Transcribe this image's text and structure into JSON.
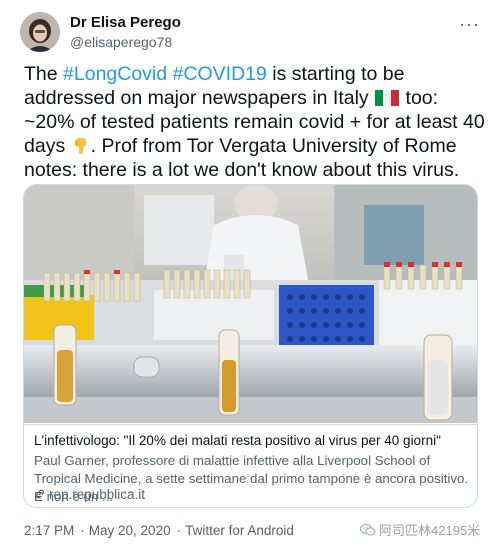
{
  "author": {
    "name": "Dr Elisa Perego",
    "handle": "@elisaperego78"
  },
  "menu_icon": "more-horizontal-icon",
  "tweet": {
    "segments": [
      {
        "text": "The ",
        "type": "text"
      },
      {
        "text": "#LongCovid",
        "type": "hashtag"
      },
      {
        "text": " ",
        "type": "text"
      },
      {
        "text": "#COVID19",
        "type": "hashtag"
      },
      {
        "text": " is starting to be addressed on major newspapers in Italy ",
        "type": "text"
      },
      {
        "type": "emoji",
        "name": "italy-flag-icon"
      },
      {
        "text": " too: ~20% of tested patients remain covid + for at least 40 days ",
        "type": "text"
      },
      {
        "type": "emoji",
        "name": "pointing-down-icon"
      },
      {
        "text": ". Prof from Tor Vergata University of Rome notes: there is a lot we don't know about this virus.",
        "type": "text"
      }
    ]
  },
  "card": {
    "title": "L'infettivologo: \"Il 20% dei malati resta positivo al virus per 40 giorni\"",
    "description": "Paul Garner, professore di malattie infettive alla Liverpool School of Tropical Medicine, a sette settimane dal primo tampone è ancora positivo. E non è un ...",
    "domain": "rep.repubblica.it",
    "link_icon": "link-icon",
    "image_icon": "lab-test-tubes-photo"
  },
  "footer": {
    "time": "2:17 PM",
    "date": "May 20, 2020",
    "source": "Twitter for Android"
  },
  "watermark": {
    "text": "阿司匹林42195米",
    "icon": "wechat-icon"
  },
  "colors": {
    "link": "#1d9bf0",
    "secondary_text": "#536471",
    "border": "#cfd9de"
  }
}
